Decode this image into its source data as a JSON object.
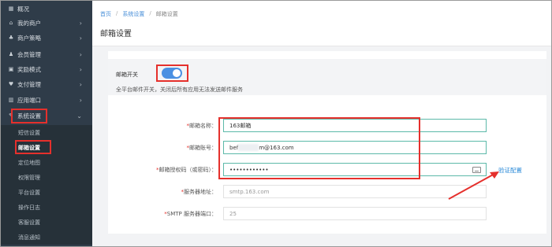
{
  "sidebar": {
    "items": [
      {
        "label": "概况",
        "icon": "chart-icon",
        "has_chevron": false
      },
      {
        "label": "我的商户",
        "icon": "home-icon",
        "has_chevron": true
      },
      {
        "label": "商户策略",
        "icon": "users-icon",
        "has_chevron": true
      },
      {
        "label": "会员管理",
        "icon": "member-icon",
        "has_chevron": true
      },
      {
        "label": "奖励模式",
        "icon": "gift-icon",
        "has_chevron": true
      },
      {
        "label": "支付管理",
        "icon": "heart-icon",
        "has_chevron": true
      },
      {
        "label": "应用端口",
        "icon": "bar-chart-icon",
        "has_chevron": true
      },
      {
        "label": "系统设置",
        "icon": "wrench-icon",
        "has_chevron": true,
        "expanded": true
      }
    ],
    "sub_items": [
      {
        "label": "短信设置"
      },
      {
        "label": "邮箱设置",
        "active": true
      },
      {
        "label": "定位地图"
      },
      {
        "label": "权限管理"
      },
      {
        "label": "平台设置"
      },
      {
        "label": "操作日志"
      },
      {
        "label": "客服设置"
      },
      {
        "label": "消息通知"
      }
    ]
  },
  "breadcrumb": {
    "home": "首页",
    "section": "系统设置",
    "current": "邮箱设置",
    "separator": "/"
  },
  "page_title": "邮箱设置",
  "switch": {
    "label": "邮箱开关",
    "on": true,
    "description": "全平台邮件开关，关闭后所有应用无法发送邮件服务"
  },
  "form": {
    "name": {
      "label": "邮箱名称：",
      "value": "163邮箱"
    },
    "account": {
      "label": "邮箱账号：",
      "value_prefix": "bef",
      "value_suffix": "m@163.com"
    },
    "auth_code": {
      "label": "邮箱授权码（或密码）：",
      "value": "••••••••••••"
    },
    "server": {
      "label": "服务器地址：",
      "value": "smtp.163.com"
    },
    "port": {
      "label": "SMTP 服务器端口：",
      "value": "25"
    },
    "required_mark": "*"
  },
  "verify_link": "验证配置",
  "colors": {
    "sidebar_bg": "#2f3c49",
    "accent": "#4a90e2",
    "highlight": "#e5302c",
    "input_border": "#5cb9a9",
    "link": "#2a8ad8"
  }
}
